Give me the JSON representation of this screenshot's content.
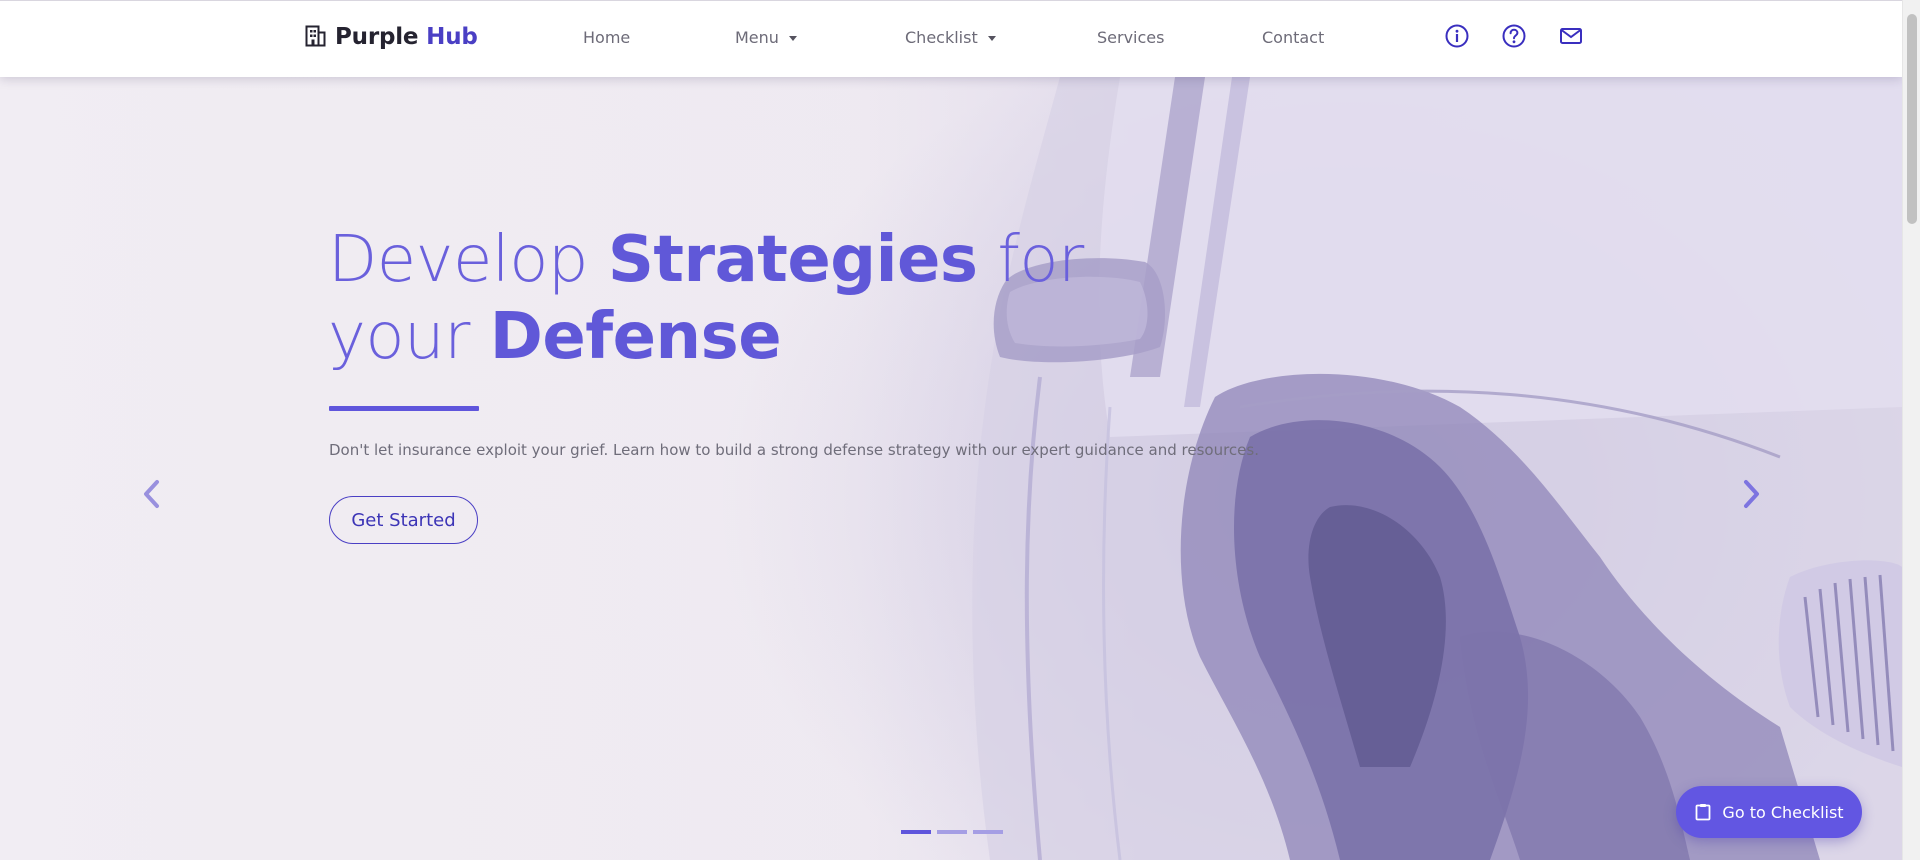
{
  "brand": {
    "name_primary": "Purple",
    "name_accent": "Hub",
    "icon": "building-icon"
  },
  "nav": {
    "items": [
      {
        "label": "Home"
      },
      {
        "label": "Menu",
        "dropdown": true
      },
      {
        "label": "Checklist",
        "dropdown": true
      },
      {
        "label": "Services"
      },
      {
        "label": "Contact"
      }
    ],
    "icons": [
      "info-icon",
      "help-icon",
      "mail-icon"
    ]
  },
  "hero": {
    "headline": {
      "part1": "Develop ",
      "part2_strong": "Strategies",
      "part3": " for",
      "part4": "your ",
      "part5_strong": "Defense"
    },
    "tagline": "Don't let insurance exploit your grief. Learn how to build a strong defense strategy with our expert guidance and resources.",
    "cta_label": "Get Started",
    "background": "wrecked-car-photo",
    "slides": {
      "count": 3,
      "active": 1
    }
  },
  "carousel": {
    "prev_icon": "chevron-left-icon",
    "next_icon": "chevron-right-icon"
  },
  "fab": {
    "label": "Go to Checklist",
    "icon": "clipboard-icon"
  },
  "colors": {
    "accent": "#5f55dc",
    "brand_accent": "#4a3fc4",
    "fab": "#6256e2",
    "text_muted": "#6d6b78",
    "hero_background": "#eee9f1"
  }
}
